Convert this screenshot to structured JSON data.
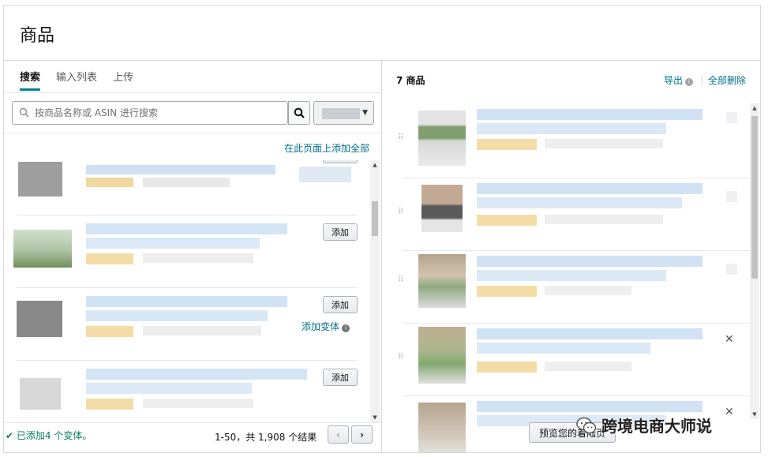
{
  "page": {
    "title": "商品"
  },
  "tabs": [
    {
      "label": "搜索",
      "active": true
    },
    {
      "label": "输入列表",
      "active": false
    },
    {
      "label": "上传",
      "active": false
    }
  ],
  "search": {
    "placeholder": "按商品名称或 ASIN 进行搜索",
    "value": "",
    "search_icon": "search-icon"
  },
  "left_panel": {
    "add_all_link": "在此页面上添加全部",
    "rows": [
      {
        "button": "添加"
      },
      {
        "button": "添加",
        "variant_link": "添加变体"
      },
      {
        "button": "添加"
      }
    ],
    "status": "已添加4 个变体。",
    "pager_text": "1-50，共 1,908 个结果",
    "prev_icon": "chevron-left-icon",
    "next_icon": "chevron-right-icon"
  },
  "right_panel": {
    "count_label": "7 商品",
    "export_link": "导出",
    "delete_all_link": "全部删除",
    "remove_icon": "close-icon",
    "remove_glyph": "✕",
    "preview_button": "预览您的着陆页"
  },
  "watermark": {
    "text": "跨境电商大师说"
  },
  "colors": {
    "link": "#007185",
    "tab_accent": "#008296",
    "status_green": "#067d62",
    "border": "#d5d9d9"
  }
}
